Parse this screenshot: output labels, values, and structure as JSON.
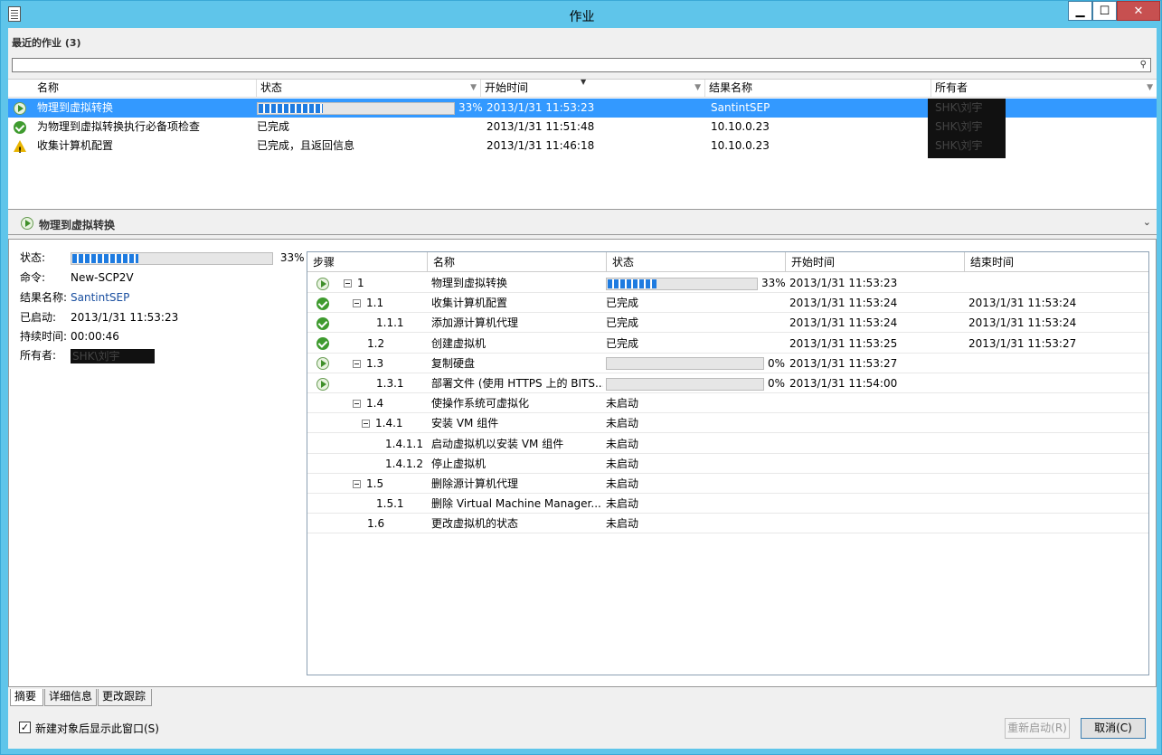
{
  "window": {
    "title": "作业",
    "min_label": "▁",
    "max_label": "☐",
    "close_label": "✕"
  },
  "recent": {
    "label": "最近的作业 (3)",
    "search_placeholder": ""
  },
  "joblist": {
    "columns": [
      "名称",
      "状态",
      "开始时间",
      "结果名称",
      "所有者"
    ],
    "rows": [
      {
        "icon": "play-icon",
        "name": "物理到虚拟转换",
        "status_progress": 0.33,
        "status_pct": "33%",
        "status": "",
        "start": "2013/1/31 11:53:23",
        "result": "SantintSEP",
        "owner": "SHK\\刘宇"
      },
      {
        "icon": "check-icon",
        "name": "为物理到虚拟转换执行必备项检查",
        "status": "已完成",
        "start": "2013/1/31 11:51:48",
        "result": "10.10.0.23",
        "owner": "SHK\\刘宇"
      },
      {
        "icon": "warning-icon",
        "name": "收集计算机配置",
        "status": "已完成，且返回信息",
        "start": "2013/1/31 11:46:18",
        "result": "10.10.0.23",
        "owner": "SHK\\刘宇"
      }
    ]
  },
  "detail": {
    "title": "物理到虚拟转换",
    "summary": {
      "status_label": "状态:",
      "status_progress": 0.33,
      "status_pct": "33%",
      "command_label": "命令:",
      "command": "New-SCP2V",
      "result_label": "结果名称:",
      "result": "SantintSEP",
      "started_label": "已启动:",
      "started": "2013/1/31 11:53:23",
      "duration_label": "持续时间:",
      "duration": "00:00:46",
      "owner_label": "所有者:",
      "owner": "SHK\\刘宇"
    },
    "steps": {
      "columns": [
        "步骤",
        "名称",
        "状态",
        "开始时间",
        "结束时间"
      ],
      "rows": [
        {
          "icon": "play-icon",
          "step": "1",
          "indent": 0,
          "expander": true,
          "name": "物理到虚拟转换",
          "progress": 0.33,
          "pct": "33%",
          "status": "",
          "start": "2013/1/31 11:53:23",
          "end": ""
        },
        {
          "icon": "check-icon",
          "step": "1.1",
          "indent": 1,
          "expander": true,
          "name": "收集计算机配置",
          "status": "已完成",
          "start": "2013/1/31 11:53:24",
          "end": "2013/1/31 11:53:24"
        },
        {
          "icon": "check-icon",
          "step": "1.1.1",
          "indent": 2,
          "expander": false,
          "name": "添加源计算机代理",
          "status": "已完成",
          "start": "2013/1/31 11:53:24",
          "end": "2013/1/31 11:53:24"
        },
        {
          "icon": "check-icon",
          "step": "1.2",
          "indent": 1,
          "expander": false,
          "name": "创建虚拟机",
          "status": "已完成",
          "start": "2013/1/31 11:53:25",
          "end": "2013/1/31 11:53:27"
        },
        {
          "icon": "play-icon",
          "step": "1.3",
          "indent": 1,
          "expander": true,
          "name": "复制硬盘",
          "progress": 0.0,
          "pct": "0%",
          "status": "",
          "start": "2013/1/31 11:53:27",
          "end": ""
        },
        {
          "icon": "play-icon",
          "step": "1.3.1",
          "indent": 2,
          "expander": false,
          "name": "部署文件 (使用  HTTPS 上的 BITS...",
          "progress": 0.0,
          "pct": "0%",
          "status": "",
          "start": "2013/1/31 11:54:00",
          "end": ""
        },
        {
          "icon": "",
          "step": "1.4",
          "indent": 1,
          "expander": true,
          "name": "使操作系统可虚拟化",
          "status": "未启动",
          "start": "",
          "end": ""
        },
        {
          "icon": "",
          "step": "1.4.1",
          "indent": 2,
          "expander": true,
          "name": "安装 VM 组件",
          "status": "未启动",
          "start": "",
          "end": ""
        },
        {
          "icon": "",
          "step": "1.4.1.1",
          "indent": 3,
          "expander": false,
          "name": "启动虚拟机以安装 VM 组件",
          "status": "未启动",
          "start": "",
          "end": ""
        },
        {
          "icon": "",
          "step": "1.4.1.2",
          "indent": 3,
          "expander": false,
          "name": "停止虚拟机",
          "status": "未启动",
          "start": "",
          "end": ""
        },
        {
          "icon": "",
          "step": "1.5",
          "indent": 1,
          "expander": true,
          "name": "删除源计算机代理",
          "status": "未启动",
          "start": "",
          "end": ""
        },
        {
          "icon": "",
          "step": "1.5.1",
          "indent": 2,
          "expander": false,
          "name": "删除 Virtual Machine Manager...",
          "status": "未启动",
          "start": "",
          "end": ""
        },
        {
          "icon": "",
          "step": "1.6",
          "indent": 1,
          "expander": false,
          "name": "更改虚拟机的状态",
          "status": "未启动",
          "start": "",
          "end": ""
        }
      ]
    }
  },
  "tabs": [
    "摘要",
    "详细信息",
    "更改跟踪"
  ],
  "footer": {
    "checkbox_label": "新建对象后显示此窗口(S)",
    "checkbox_checked": true,
    "restart_label": "重新启动(R)",
    "cancel_label": "取消(C)"
  },
  "colors": {
    "titlebar": "#5fc5ea",
    "selection": "#3399ff",
    "progress": "#1e7be0",
    "close": "#c75050"
  }
}
